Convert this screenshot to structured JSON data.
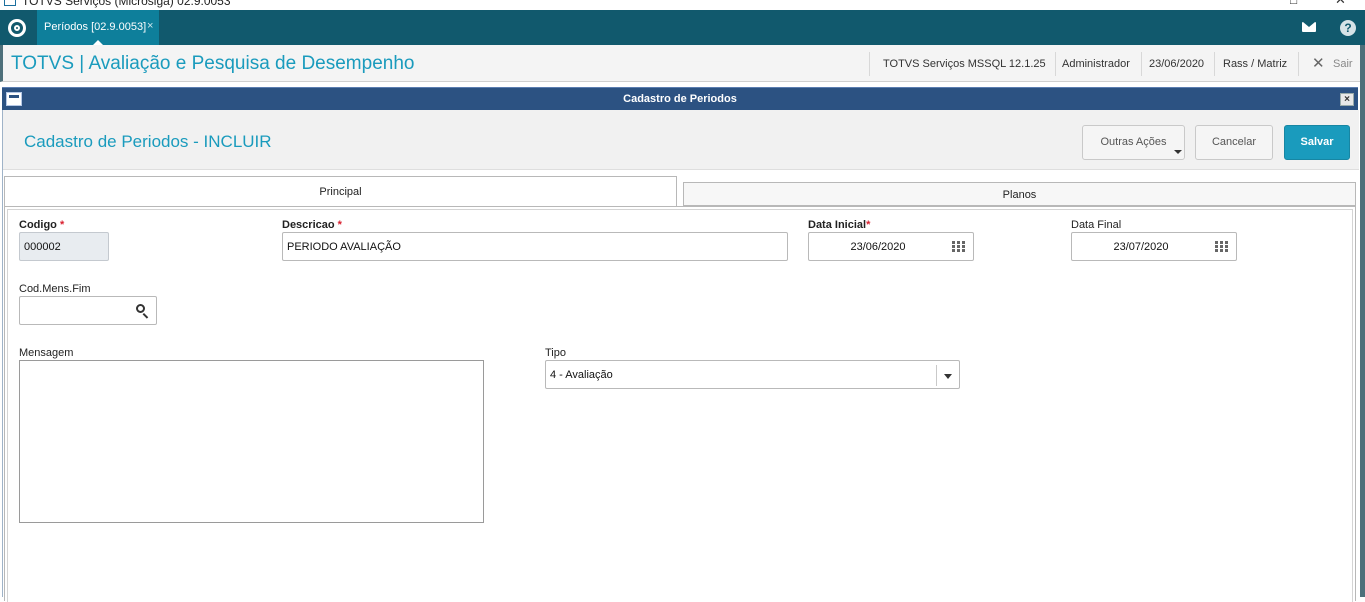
{
  "window": {
    "title": "TOTVS Serviços (Microsiga) 02.9.0053"
  },
  "tabbar": {
    "active_tab": "Períodos [02.9.0053]",
    "close_glyph": "×"
  },
  "header": {
    "app_title": "TOTVS | Avaliação e Pesquisa de Desempenho",
    "environment": "TOTVS Serviços MSSQL 12.1.25",
    "user": "Administrador",
    "date": "23/06/2020",
    "branch": "Rass / Matriz",
    "exit_label": "Sair"
  },
  "dialog": {
    "title": "Cadastro de Periodos",
    "close_glyph": "×",
    "form_title": "Cadastro de Periodos - INCLUIR",
    "buttons": {
      "other_actions": "Outras Ações",
      "cancel": "Cancelar",
      "save": "Salvar"
    },
    "tabs": [
      "Principal",
      "Planos"
    ],
    "fields": {
      "codigo": {
        "label": "Codigo",
        "required": "*",
        "value": "000002"
      },
      "descricao": {
        "label": "Descricao",
        "required": "*",
        "value": "PERIODO AVALIAÇÃO"
      },
      "data_inicial": {
        "label": "Data Inicial",
        "required": "*",
        "value": "23/06/2020"
      },
      "data_final": {
        "label": "Data Final",
        "value": "23/07/2020"
      },
      "cod_mens_fim": {
        "label": "Cod.Mens.Fim",
        "value": ""
      },
      "mensagem": {
        "label": "Mensagem",
        "value": ""
      },
      "tipo": {
        "label": "Tipo",
        "value": "4 - Avaliação"
      }
    }
  },
  "colors": {
    "tabbar": "#11596d",
    "accent": "#1a9bbd",
    "dialog_titlebar": "#2c5282",
    "required": "#d9202f"
  },
  "icons": [
    "home-icon",
    "mail-icon",
    "help-icon",
    "close-icon",
    "calendar-icon",
    "search-icon",
    "chevron-down-icon"
  ]
}
